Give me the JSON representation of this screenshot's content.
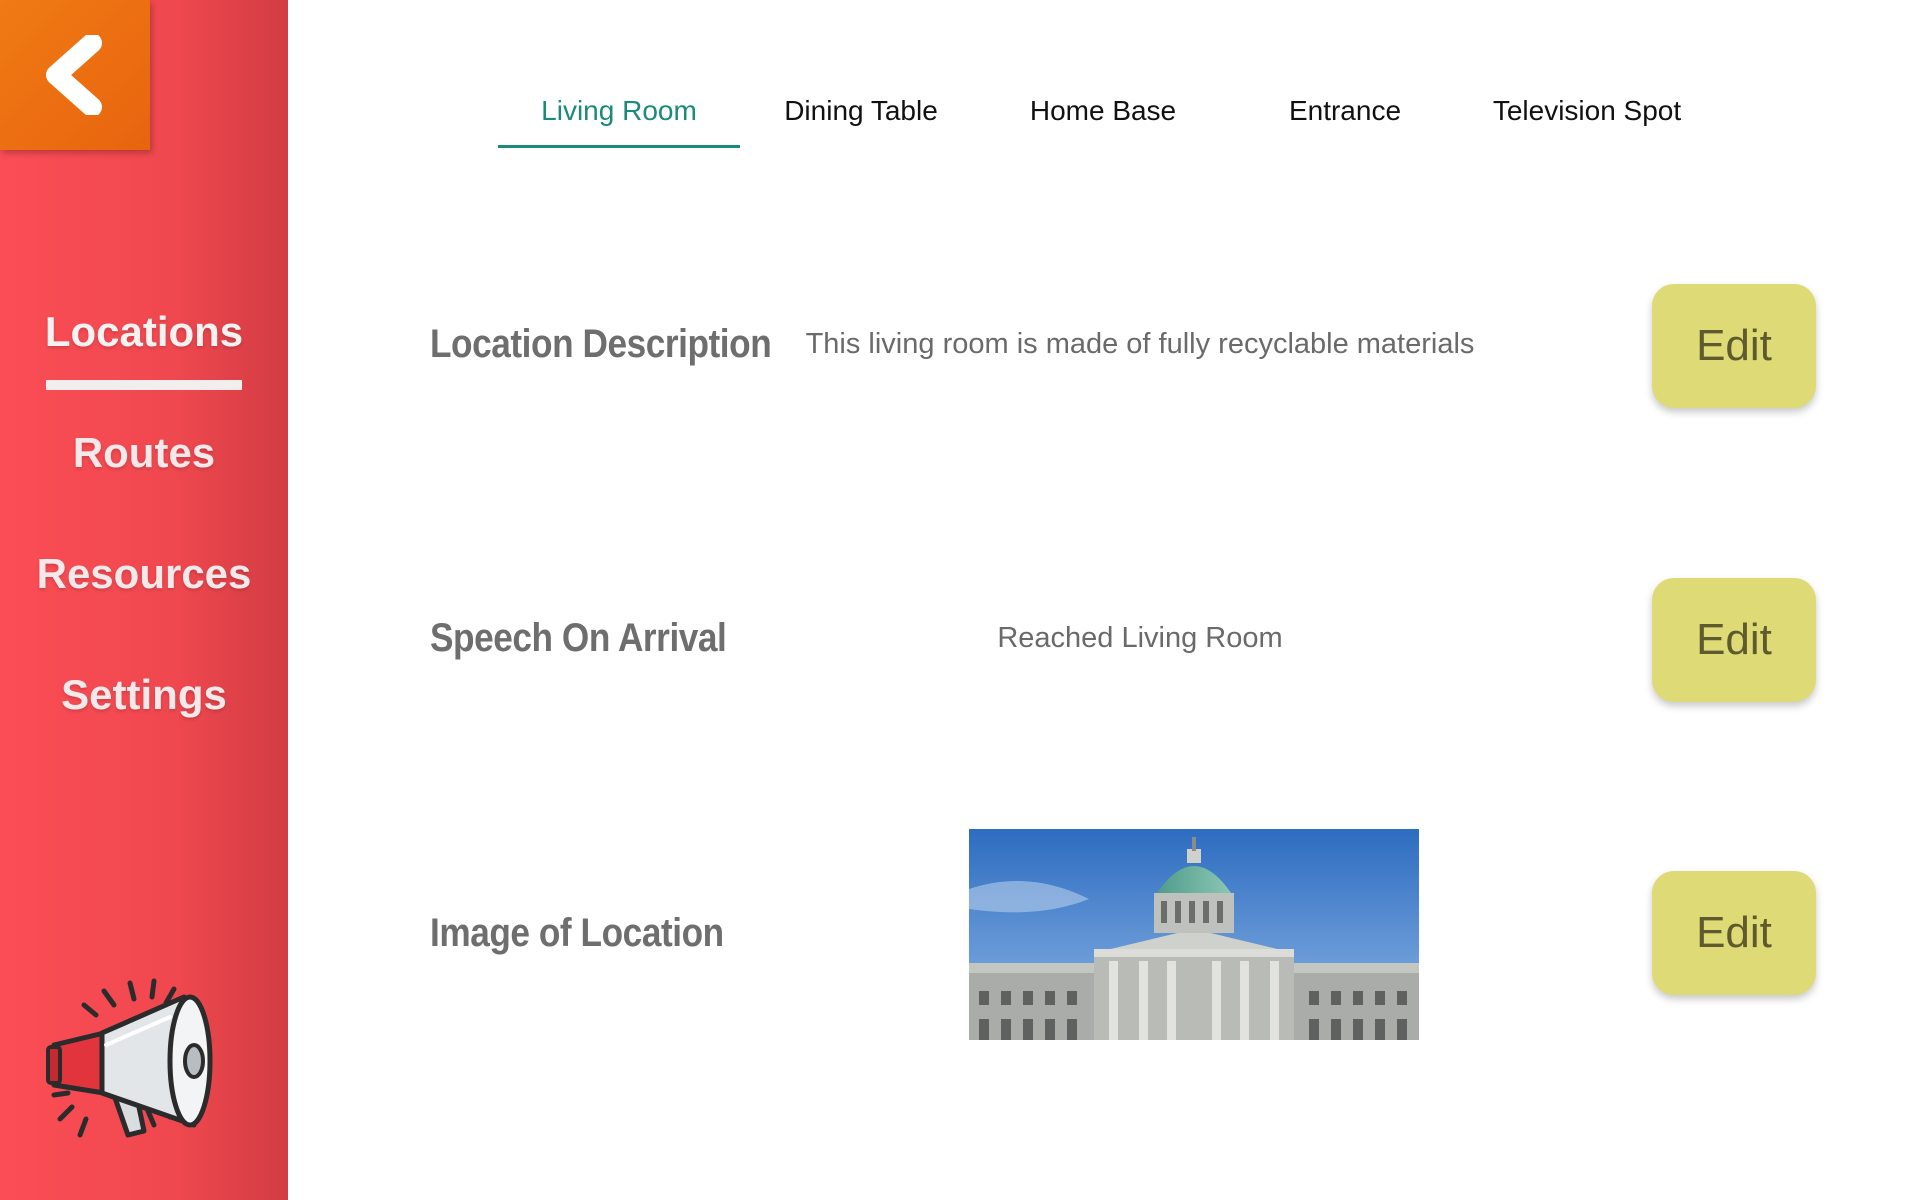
{
  "sidebar": {
    "items": [
      {
        "label": "Locations",
        "active": true
      },
      {
        "label": "Routes",
        "active": false
      },
      {
        "label": "Resources",
        "active": false
      },
      {
        "label": "Settings",
        "active": false
      }
    ],
    "back_icon": "chevron-left-icon",
    "bottom_icon": "megaphone-icon"
  },
  "tabs": [
    {
      "label": "Living Room",
      "active": true
    },
    {
      "label": "Dining Table",
      "active": false
    },
    {
      "label": "Home Base",
      "active": false
    },
    {
      "label": "Entrance",
      "active": false
    },
    {
      "label": "Television Spot",
      "active": false
    }
  ],
  "rows": {
    "description": {
      "label": "Location Description",
      "value": "This living room is made of fully recyclable materials",
      "edit_label": "Edit"
    },
    "speech": {
      "label": "Speech On Arrival",
      "value": "Reached Living Room",
      "edit_label": "Edit"
    },
    "image": {
      "label": "Image of Location",
      "edit_label": "Edit"
    }
  },
  "colors": {
    "sidebar": "#f84c54",
    "back_button": "#ee7214",
    "active_tab": "#1a8a7a",
    "edit_button": "#dedb77"
  }
}
